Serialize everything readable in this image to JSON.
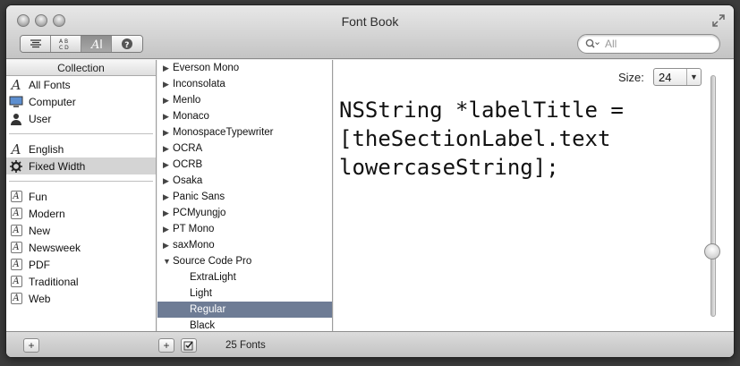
{
  "window": {
    "title": "Font Book"
  },
  "search": {
    "placeholder": "All"
  },
  "collection": {
    "header": "Collection",
    "groups": [
      [
        {
          "label": "All Fonts",
          "icon": "all-fonts-icon"
        },
        {
          "label": "Computer",
          "icon": "computer-icon"
        },
        {
          "label": "User",
          "icon": "user-icon"
        }
      ],
      [
        {
          "label": "English",
          "icon": "language-icon"
        },
        {
          "label": "Fixed Width",
          "icon": "gear-icon",
          "selected": true
        }
      ],
      [
        {
          "label": "Fun",
          "icon": "collection-icon"
        },
        {
          "label": "Modern",
          "icon": "collection-icon"
        },
        {
          "label": "New",
          "icon": "collection-icon"
        },
        {
          "label": "Newsweek",
          "icon": "collection-icon"
        },
        {
          "label": "PDF",
          "icon": "collection-icon"
        },
        {
          "label": "Traditional",
          "icon": "collection-icon"
        },
        {
          "label": "Web",
          "icon": "collection-icon"
        }
      ]
    ]
  },
  "fonts": [
    {
      "label": "Everson Mono",
      "expanded": false
    },
    {
      "label": "Inconsolata",
      "expanded": false
    },
    {
      "label": "Menlo",
      "expanded": false
    },
    {
      "label": "Monaco",
      "expanded": false
    },
    {
      "label": "MonospaceTypewriter",
      "expanded": false
    },
    {
      "label": "OCRA",
      "expanded": false
    },
    {
      "label": "OCRB",
      "expanded": false
    },
    {
      "label": "Osaka",
      "expanded": false
    },
    {
      "label": "Panic Sans",
      "expanded": false
    },
    {
      "label": "PCMyungjo",
      "expanded": false
    },
    {
      "label": "PT Mono",
      "expanded": false
    },
    {
      "label": "saxMono",
      "expanded": false
    },
    {
      "label": "Source Code Pro",
      "expanded": true
    },
    {
      "label": "ExtraLight",
      "sub": true
    },
    {
      "label": "Light",
      "sub": true
    },
    {
      "label": "Regular",
      "sub": true,
      "selected": true
    },
    {
      "label": "Black",
      "sub": true
    }
  ],
  "preview": {
    "size_label": "Size:",
    "size_value": "24",
    "lines": [
      "NSString *labelTitle =",
      "[theSectionLabel.text",
      "lowercaseString];"
    ],
    "slider_level": 0.73
  },
  "status": {
    "font_count": "25 Fonts"
  },
  "colors": {
    "selection": "#6e7c95",
    "collection_selection": "#d4d4d4"
  }
}
